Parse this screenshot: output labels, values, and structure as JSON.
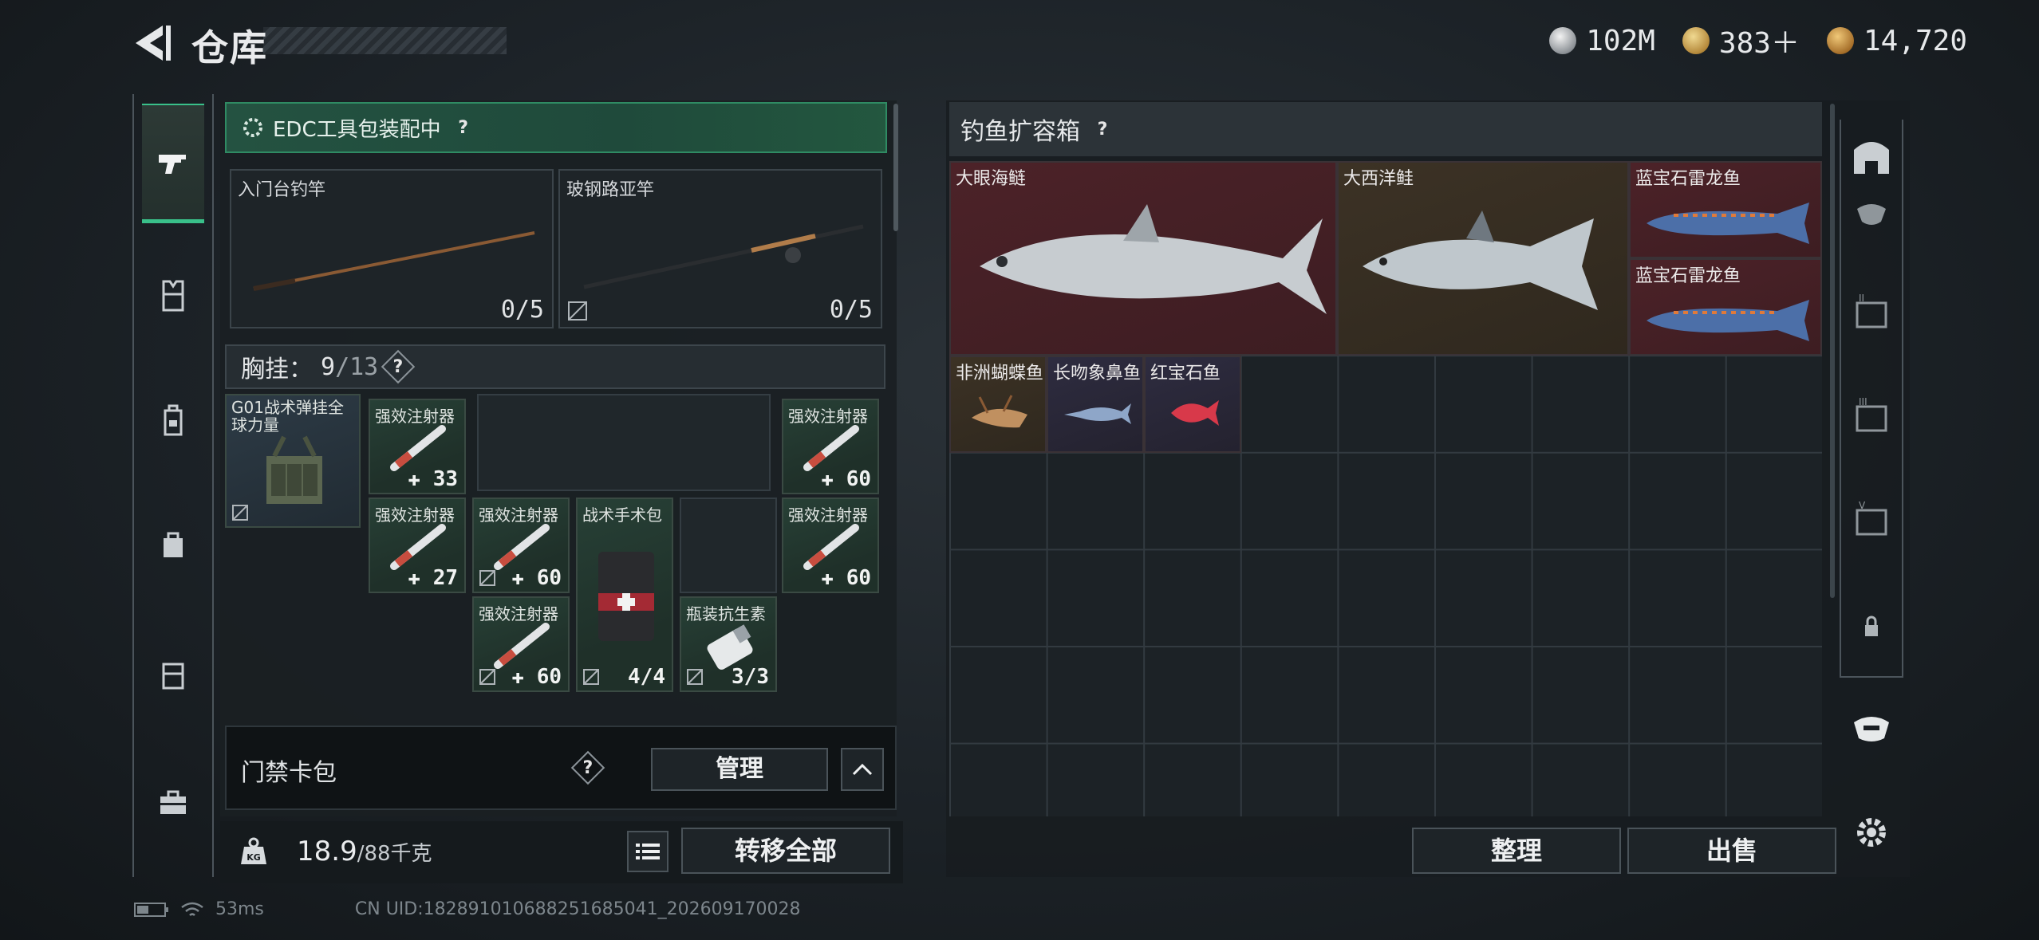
{
  "header": {
    "title": "仓库",
    "currencies": [
      {
        "icon": "silver-coin-icon",
        "value": "102M"
      },
      {
        "icon": "gold-triangle-coin-icon",
        "value": "383＋"
      },
      {
        "icon": "bronze-coin-icon",
        "value": "14,720"
      }
    ]
  },
  "inventory": {
    "edc_label": "EDC工具包装配中",
    "help": "?",
    "rods": [
      {
        "name": "入门台钓竿",
        "count": "0/5"
      },
      {
        "name": "玻钢路亚竿",
        "count": "0/5"
      }
    ],
    "chest": {
      "label": "胸挂：",
      "used": "9",
      "total": "/13",
      "rig_name": "G01战术弹挂全球力量",
      "items": [
        {
          "name": "强效注射器",
          "qty": "33"
        },
        {
          "name": "强效注射器",
          "qty": "60"
        },
        {
          "name": "强效注射器",
          "qty": "27"
        },
        {
          "name": "强效注射器",
          "qty": "60"
        },
        {
          "name": "战术手术包",
          "qty": "4/4"
        },
        {
          "name": "强效注射器",
          "qty": "60"
        },
        {
          "name": "强效注射器",
          "qty": "60"
        },
        {
          "name": "瓶装抗生素",
          "qty": "3/3"
        }
      ]
    },
    "access": {
      "label": "门禁卡包",
      "manage": "管理"
    },
    "weight": {
      "value": "18.9",
      "max": "/88千克"
    },
    "transfer_all": "转移全部"
  },
  "fishbox": {
    "title": "钓鱼扩容箱",
    "fish": [
      {
        "name": "大眼海鲢"
      },
      {
        "name": "大西洋鲑"
      },
      {
        "name": "蓝宝石雷龙鱼"
      },
      {
        "name": "蓝宝石雷龙鱼"
      },
      {
        "name": "非洲蝴蝶鱼"
      },
      {
        "name": "长吻象鼻鱼"
      },
      {
        "name": "红宝石鱼"
      }
    ],
    "sort": "整理",
    "sell": "出售"
  },
  "footer": {
    "ping": "53ms",
    "uid": "CN UID:1828910106882516850­41_202609170028"
  },
  "colors": {
    "accent_green": "#39c08a",
    "rare_red": "#4c2228"
  }
}
